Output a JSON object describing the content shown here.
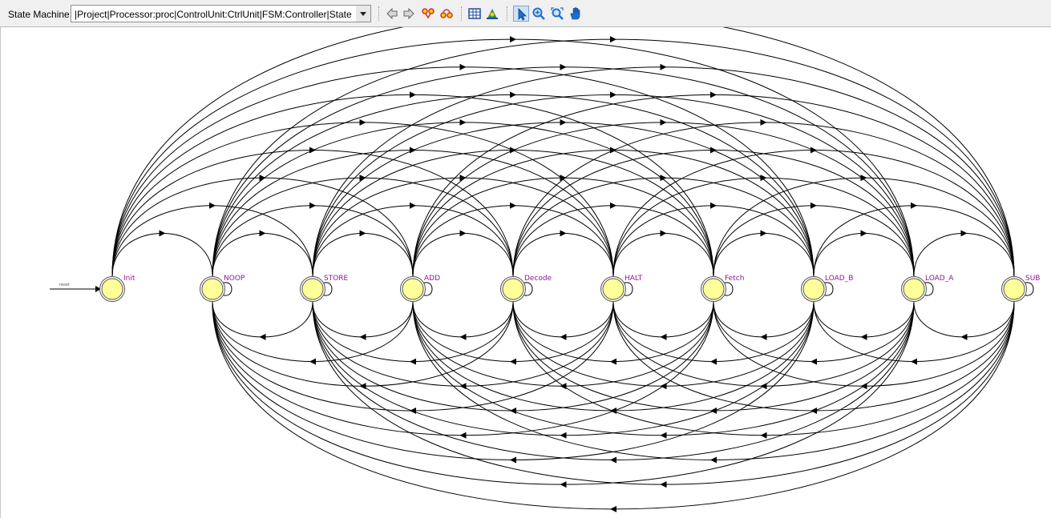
{
  "toolbar": {
    "label": "State Machine:",
    "selected_machine": "|Project|Processor:proc|ControlUnit:CtrlUnit|FSM:Controller|State",
    "buttons": [
      {
        "name": "back-button",
        "icon": "back-arrow-icon"
      },
      {
        "name": "forward-button",
        "icon": "forward-arrow-icon"
      },
      {
        "name": "show-transitions-button",
        "icon": "transitions-icon"
      },
      {
        "name": "show-encoding-button",
        "icon": "encoding-icon"
      },
      {
        "name": "table-view-button",
        "icon": "table-icon"
      },
      {
        "name": "highlight-button",
        "icon": "highlight-icon"
      },
      {
        "name": "select-tool-button",
        "icon": "pointer-icon",
        "active": true
      },
      {
        "name": "zoom-in-button",
        "icon": "zoom-in-icon"
      },
      {
        "name": "zoom-fit-button",
        "icon": "zoom-fit-icon"
      },
      {
        "name": "pan-tool-button",
        "icon": "hand-icon"
      }
    ]
  },
  "diagram": {
    "reset_label": "reset",
    "initial_state": "Init",
    "states": [
      "Init",
      "NOOP",
      "STORE",
      "ADD",
      "Decode",
      "HALT",
      "Fetch",
      "LOAD_B",
      "LOAD_A",
      "SUB"
    ],
    "colors": {
      "state_fill": "#ffff99",
      "state_stroke": "#555555",
      "label": "#8b1a8b",
      "edge": "#000000"
    }
  }
}
